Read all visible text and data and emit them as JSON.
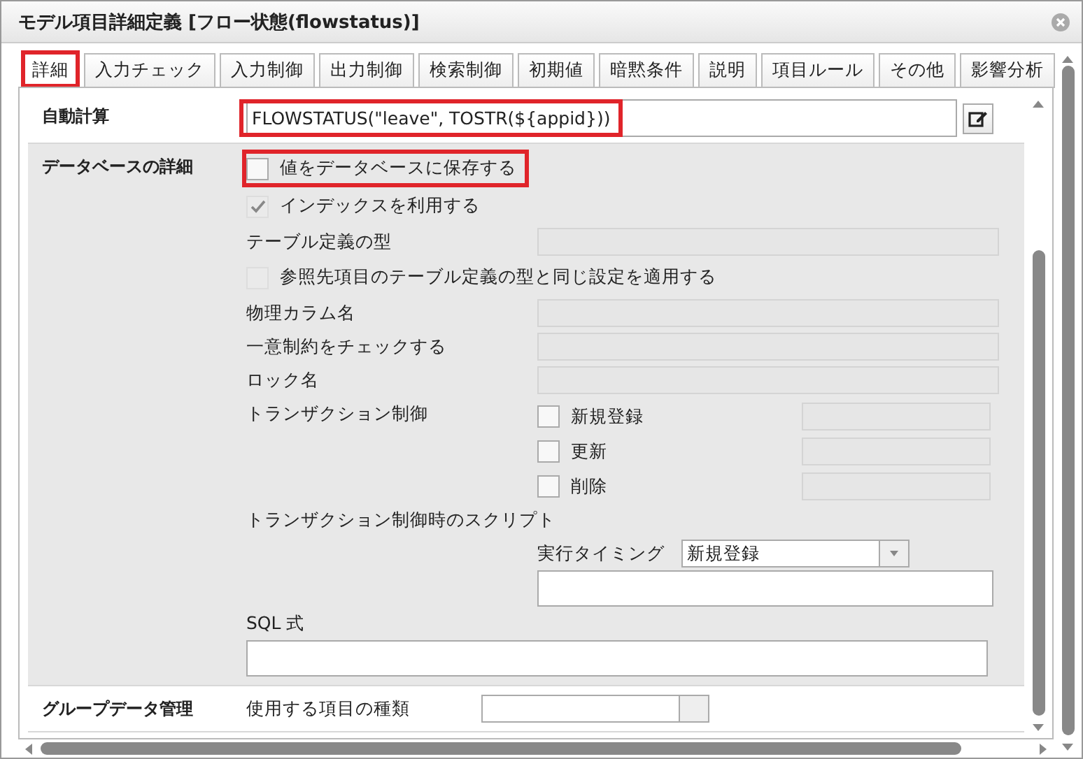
{
  "window": {
    "title": "モデル項目詳細定義 [フロー状態(flowstatus)]"
  },
  "tabs": [
    {
      "label": "詳細",
      "selected": true,
      "highlighted": true
    },
    {
      "label": "入力チェック",
      "selected": false,
      "highlighted": false
    },
    {
      "label": "入力制御",
      "selected": false,
      "highlighted": false
    },
    {
      "label": "出力制御",
      "selected": false,
      "highlighted": false
    },
    {
      "label": "検索制御",
      "selected": false,
      "highlighted": false
    },
    {
      "label": "初期値",
      "selected": false,
      "highlighted": false
    },
    {
      "label": "暗黙条件",
      "selected": false,
      "highlighted": false
    },
    {
      "label": "説明",
      "selected": false,
      "highlighted": false
    },
    {
      "label": "項目ルール",
      "selected": false,
      "highlighted": false
    },
    {
      "label": "その他",
      "selected": false,
      "highlighted": false
    },
    {
      "label": "影響分析",
      "selected": false,
      "highlighted": false
    }
  ],
  "auto_calc": {
    "label": "自動計算",
    "value": "FLOWSTATUS(\"leave\", TOSTR(${appid}))",
    "highlighted": true
  },
  "database_details": {
    "label": "データベースの詳細",
    "rows": [
      {
        "kind": "checkbox",
        "label": "値をデータベースに保存する",
        "checked": false,
        "disabled": false,
        "highlighted": true
      },
      {
        "kind": "checkbox",
        "label": "インデックスを利用する",
        "checked": true,
        "disabled": true,
        "highlighted": false
      },
      {
        "kind": "field",
        "label": "テーブル定義の型"
      },
      {
        "kind": "checkbox",
        "label": "参照先項目のテーブル定義の型と同じ設定を適用する",
        "checked": false,
        "disabled": true,
        "highlighted": false
      },
      {
        "kind": "field",
        "label": "物理カラム名"
      },
      {
        "kind": "field",
        "label": "一意制約をチェックする"
      },
      {
        "kind": "field",
        "label": "ロック名"
      }
    ],
    "transaction": {
      "label": "トランザクション制御",
      "options": [
        {
          "label": "新規登録",
          "checked": false
        },
        {
          "label": "更新",
          "checked": false
        },
        {
          "label": "削除",
          "checked": false
        }
      ]
    },
    "script": {
      "label": "トランザクション制御時のスクリプト",
      "timing_label": "実行タイミング",
      "timing_value": "新規登録"
    },
    "sql": {
      "label": "SQL 式"
    }
  },
  "group_data": {
    "label": "グループデータ管理",
    "item_type_label": "使用する項目の種類"
  }
}
